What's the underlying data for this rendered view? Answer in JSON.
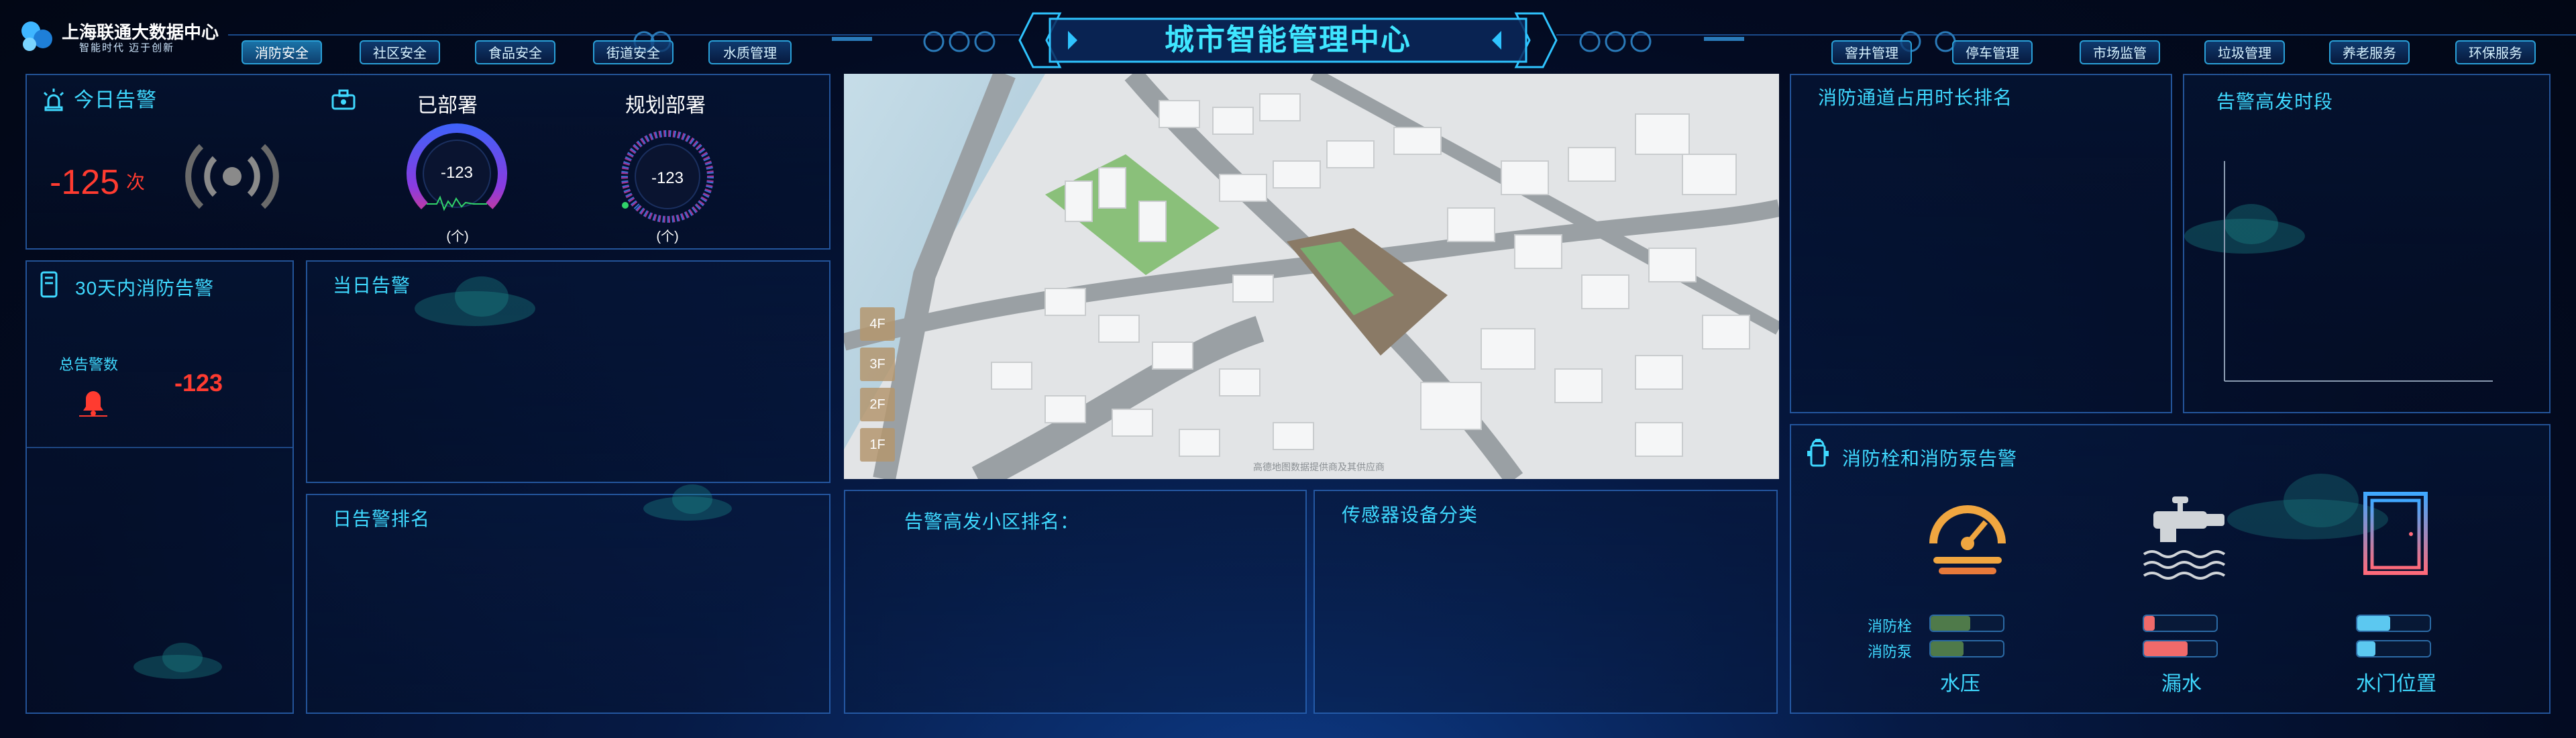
{
  "logo": {
    "name": "上海联通大数据中心",
    "slogan": "智能时代 迈于创新"
  },
  "header": {
    "title": "城市智能管理中心"
  },
  "nav_left": [
    "消防安全",
    "社区安全",
    "食品安全",
    "街道安全",
    "水质管理"
  ],
  "nav_right": [
    "窨井管理",
    "停车管理",
    "市场监管",
    "垃圾管理",
    "养老服务",
    "环保服务"
  ],
  "alarm_today": {
    "title": "今日告警",
    "value": "-125",
    "unit": "次",
    "deployed_label": "已部署",
    "planned_label": "规划部署",
    "gauge1_value": "-123",
    "gauge2_value": "-123",
    "unit_label": "(个)"
  },
  "fire_30days": {
    "title": "30天内消防告警",
    "total_label": "总告警数",
    "total_value": "-123"
  },
  "day_alarm": {
    "title": "当日告警"
  },
  "day_rank": {
    "title": "日告警排名"
  },
  "map": {
    "floors": [
      "4F",
      "3F",
      "2F",
      "1F"
    ],
    "watermark": "高德地图数据提供商及其供应商"
  },
  "community_rank": {
    "title": "告警高发小区排名："
  },
  "sensor_class": {
    "title": "传感器设备分类"
  },
  "fire_passage": {
    "title": "消防通道占用时长排名"
  },
  "alarm_period": {
    "title": "告警高发时段"
  },
  "hydrant": {
    "title": "消防栓和消防泵告警",
    "hydrant_label": "消防栓",
    "pump_label": "消防泵",
    "groups": [
      {
        "label": "水压",
        "hydrant_level": 0.55,
        "pump_level": 0.45,
        "color": "#4f7a4a"
      },
      {
        "label": "漏水",
        "hydrant_level": 0.15,
        "pump_level": 0.6,
        "color": "#f06a6a"
      },
      {
        "label": "水门位置",
        "hydrant_level": 0.45,
        "pump_level": 0.25,
        "color": "#5cc8f0"
      }
    ]
  },
  "colors": {
    "accent": "#3fd9ff",
    "alarm_red": "#ff3b30",
    "border": "#3478d2"
  }
}
